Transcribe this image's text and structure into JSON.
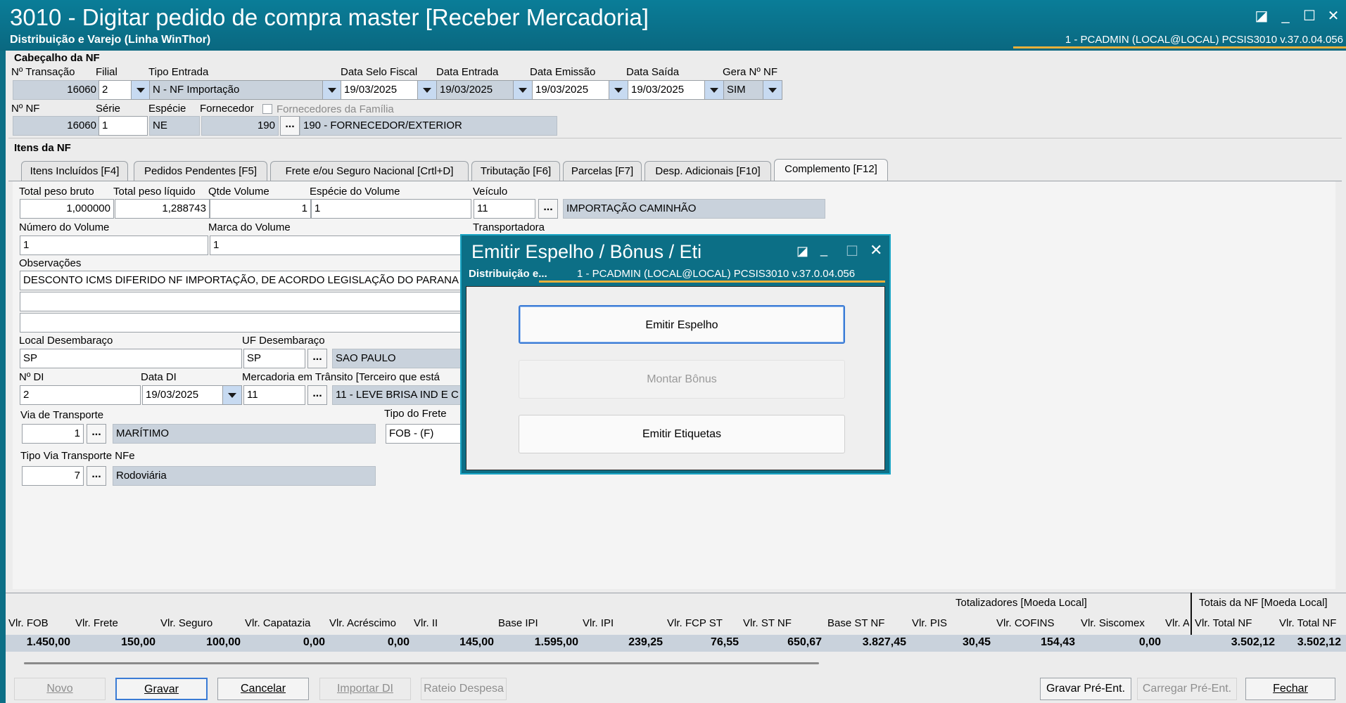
{
  "window": {
    "title": "3010 - Digitar pedido de compra master [Receber Mercadoria]",
    "subtitle": "Distribuição e Varejo (Linha WinThor)",
    "user_info": "1 - PCADMIN (LOCAL@LOCAL)   PCSIS3010  v.37.0.04.056",
    "accent": "#0c6f86"
  },
  "header": {
    "section_title": "Cabeçalho da NF",
    "transacao_label": "Nº Transação",
    "transacao_value": "16060",
    "filial_label": "Filial",
    "filial_value": "2",
    "tipo_entrada_label": "Tipo Entrada",
    "tipo_entrada_value": "N - NF Importação",
    "data_selo_label": "Data Selo Fiscal",
    "data_selo_value": "19/03/2025",
    "data_entrada_label": "Data Entrada",
    "data_entrada_value": "19/03/2025",
    "data_emissao_label": "Data Emissão",
    "data_emissao_value": "19/03/2025",
    "data_saida_label": "Data Saída",
    "data_saida_value": "19/03/2025",
    "gera_nf_label": "Gera Nº NF",
    "gera_nf_value": "SIM",
    "nf_label": "Nº NF",
    "nf_value": "16060",
    "serie_label": "Série",
    "serie_value": "1",
    "especie_label": "Espécie",
    "especie_value": "NE",
    "fornecedor_label": "Fornecedor",
    "fornecedor_code": "190",
    "fornecedor_name": "190 - FORNECEDOR/EXTERIOR",
    "familia_label": "Fornecedores da Família"
  },
  "items": {
    "section_title": "Itens da NF",
    "tabs": [
      {
        "label": "Itens Incluídos [F4]"
      },
      {
        "label": "Pedidos Pendentes [F5]"
      },
      {
        "label": "Frete e/ou Seguro Nacional [Crtl+D]"
      },
      {
        "label": "Tributação [F6]"
      },
      {
        "label": "Parcelas [F7]"
      },
      {
        "label": "Desp. Adicionais [F10]"
      },
      {
        "label": "Complemento [F12]"
      }
    ]
  },
  "complemento": {
    "peso_bruto_label": "Total peso bruto",
    "peso_bruto_value": "1,000000",
    "peso_liquido_label": "Total peso líquido",
    "peso_liquido_value": "1,288743",
    "qtde_volume_label": "Qtde Volume",
    "qtde_volume_value": "1",
    "especie_volume_label": "Espécie do Volume",
    "especie_volume_value": "1",
    "veiculo_label": "Veículo",
    "veiculo_code": "11",
    "veiculo_name": "IMPORTAÇÃO CAMINHÃO",
    "numero_volume_label": "Número do Volume",
    "numero_volume_value": "1",
    "marca_volume_label": "Marca do Volume",
    "marca_volume_value": "1",
    "transportadora_label": "Transportadora",
    "observacoes_label": "Observações",
    "observacoes_line1": "DESCONTO ICMS DIFERIDO NF IMPORTAÇÃO, DE ACORDO LEGISLAÇÃO DO PARANA",
    "local_desembaraco_label": "Local Desembaraço",
    "local_desembaraco_value": "SP",
    "uf_desembaraco_label": "UF Desembaraço",
    "uf_desembaraco_code": "SP",
    "uf_desembaraco_name": "SAO PAULO",
    "di_label": "Nº DI",
    "di_value": "2",
    "data_di_label": "Data DI",
    "data_di_value": "19/03/2025",
    "mercadoria_transito_label": "Mercadoria em Trânsito [Terceiro que está",
    "mercadoria_transito_code": "11",
    "mercadoria_transito_name": "11 - LEVE BRISA IND E C",
    "via_transporte_label": "Via de Transporte",
    "via_transporte_code": "1",
    "via_transporte_name": "MARÍTIMO",
    "tipo_frete_label": "Tipo do Frete",
    "tipo_frete_value": "FOB - (F)",
    "tipo_via_label": "Tipo Via Transporte NFe",
    "tipo_via_code": "7",
    "tipo_via_name": "Rodoviária",
    "ellipsis": "..."
  },
  "totals": {
    "group_local": "Totalizadores [Moeda Local]",
    "group_nf": "Totais da NF [Moeda Local]",
    "columns": [
      {
        "label": "Vlr. FOB",
        "value": "1.450,00"
      },
      {
        "label": "Vlr. Frete",
        "value": "150,00"
      },
      {
        "label": "Vlr. Seguro",
        "value": "100,00"
      },
      {
        "label": "Vlr. Capatazia",
        "value": "0,00"
      },
      {
        "label": "Vlr. Acréscimo",
        "value": "0,00"
      },
      {
        "label": "Vlr. II",
        "value": "145,00"
      },
      {
        "label": "Base IPI",
        "value": "1.595,00"
      },
      {
        "label": "Vlr. IPI",
        "value": "239,25"
      },
      {
        "label": "Vlr. FCP ST",
        "value": "76,55"
      },
      {
        "label": "Vlr. ST NF",
        "value": "650,67"
      },
      {
        "label": "Base ST NF",
        "value": "3.827,45"
      },
      {
        "label": "Vlr. PIS",
        "value": "30,45"
      },
      {
        "label": "Vlr. COFINS",
        "value": "154,43"
      },
      {
        "label": "Vlr. Siscomex",
        "value": "0,00"
      },
      {
        "label": "Vlr. A",
        "value": ""
      }
    ],
    "nf_columns": [
      {
        "label": "Vlr. Total NF",
        "value": "3.502,12"
      },
      {
        "label": "Vlr. Total NF",
        "value": "3.502,12"
      }
    ]
  },
  "footer": {
    "novo": "Novo",
    "gravar": "Gravar",
    "cancelar": "Cancelar",
    "importar_di": "Importar DI",
    "rateio": "Rateio Despesa",
    "gravar_pre": "Gravar Pré-Ent.",
    "carregar_pre": "Carregar Pré-Ent.",
    "fechar": "Fechar"
  },
  "dialog": {
    "title": "Emitir Espelho / Bônus / Eti",
    "subtitle": "Distribuição e...",
    "info": "1 - PCADMIN (LOCAL@LOCAL)    PCSIS3010  v.37.0.04.056",
    "btn_espelho": "Emitir Espelho",
    "btn_bonus": "Montar Bônus",
    "btn_etiquetas": "Emitir Etiquetas"
  }
}
